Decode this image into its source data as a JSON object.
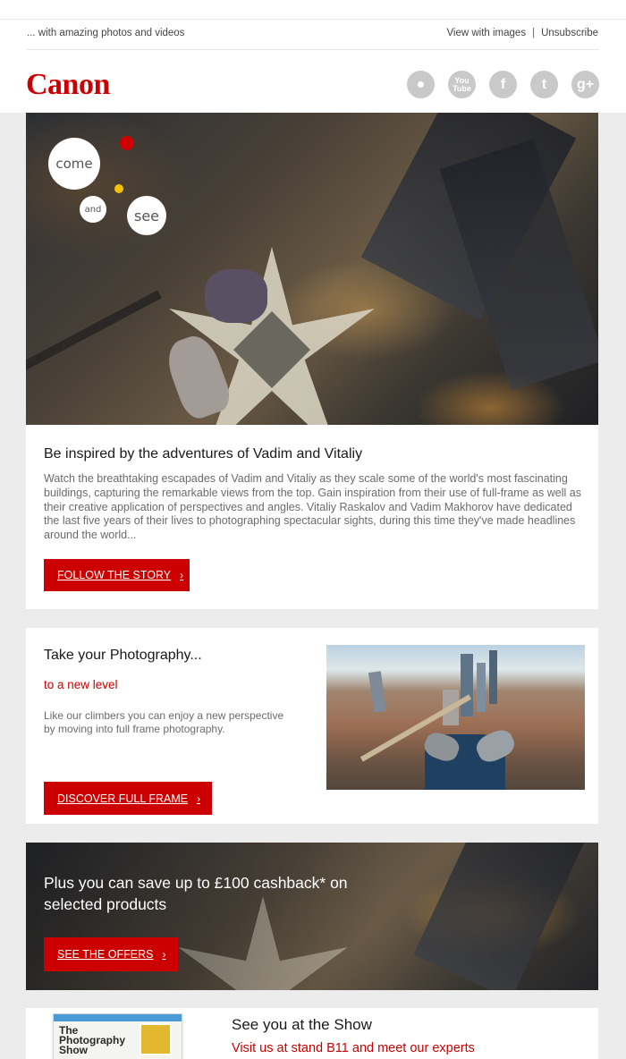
{
  "header": {
    "preheader": "... with amazing photos and videos",
    "view_images": "View with images",
    "separator": "|",
    "unsubscribe": "Unsubscribe",
    "logo": "Canon"
  },
  "socials": [
    {
      "name": "camera",
      "glyph": "●"
    },
    {
      "name": "youtube",
      "glyph": "You Tube"
    },
    {
      "name": "facebook",
      "glyph": "f"
    },
    {
      "name": "twitter",
      "glyph": "t"
    },
    {
      "name": "google-plus",
      "glyph": "g+"
    }
  ],
  "hero": {
    "bubble_come": "come",
    "bubble_and": "and",
    "bubble_see": "see"
  },
  "story": {
    "title": "Be inspired by the adventures of Vadim and Vitaliy",
    "body": "Watch the breathtaking escapades of Vadim and Vitaliy as they scale some of the world's most fascinating buildings, capturing the remarkable views from the top. Gain inspiration from their use of full-frame as well as their creative application of perspectives and angles. Vitaliy Raskalov and Vadim Makhorov have dedicated the last five years of their lives to photographing spectacular sights, during this time they've made headlines around the world...",
    "button": "FOLLOW THE STORY",
    "chevron": "›"
  },
  "fullframe": {
    "title": "Take your Photography...",
    "subtitle": "to a new level",
    "body": "Like our climbers you can enjoy a new perspective by moving into full frame photography.",
    "button": "DISCOVER FULL FRAME",
    "chevron": "›"
  },
  "offers": {
    "title": "Plus you can save up to £100 cashback* on selected products",
    "button": "SEE THE OFFERS",
    "chevron": "›"
  },
  "show": {
    "title": "See you at the Show",
    "subtitle": "Visit us at stand B11 and meet our experts",
    "magazine_title": "The Photography Show"
  },
  "colors": {
    "brand_red": "#cc0000",
    "page_bg": "#ececec"
  }
}
